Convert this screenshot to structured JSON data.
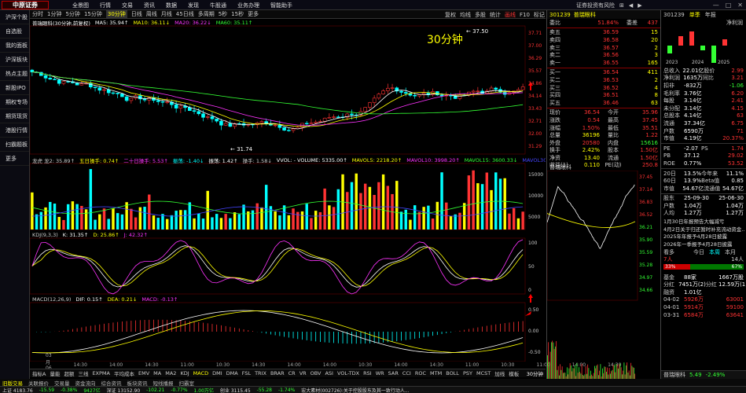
{
  "app": {
    "logo": "中原证券",
    "menu": [
      "全景图",
      "行情",
      "交易",
      "资讯",
      "数据",
      "发现",
      "牛股通",
      "业务办理",
      "智能助手"
    ],
    "top_right": [
      "证券投资有风险",
      "⊞",
      "◀",
      "▶"
    ],
    "window_controls": [
      "—",
      "□",
      "✕"
    ]
  },
  "sidebar": [
    "沪深个股",
    "自选股",
    "我的面板",
    "沪深板块",
    "热点主题",
    "新股IPO",
    "期权专场",
    "期货现货",
    "港股行情",
    "扫霸题板",
    "更多"
  ],
  "toolbar": {
    "periods": [
      "分时",
      "1分钟",
      "5分钟",
      "15分钟",
      "30分钟",
      "日线",
      "周线",
      "月线",
      "45日线",
      "多周期",
      "5秒",
      "15秒",
      "更多"
    ],
    "active_period": "30分钟",
    "tools": [
      "复权",
      "均线",
      "多股",
      "统计",
      "画线",
      "F10",
      "标记",
      "◧",
      "⊠"
    ]
  },
  "chart": {
    "title": "30分钟",
    "stock_legend": [
      {
        "t": "普瑞眼科(30分钟,前复权)",
        "c": "#fff"
      },
      {
        "t": "MA5: 35.94↑",
        "c": "#fff"
      },
      {
        "t": "MA10: 36.11↓",
        "c": "#ff0"
      },
      {
        "t": "MA20: 36.22↓",
        "c": "#f3f"
      },
      {
        "t": "MA60: 35.11↑",
        "c": "#3f3"
      }
    ],
    "price_labels": {
      "high": "37.50",
      "low": "31.74"
    },
    "y_axis": [
      "37.71",
      "37.00",
      "36.29",
      "35.57",
      "34.86",
      "34.14",
      "33.43",
      "32.71",
      "32.00",
      "31.29"
    ],
    "vol_legend": [
      {
        "t": "龙虎 龙2: 35.89↑",
        "c": "#ccc"
      },
      {
        "t": "五日操手: 0.74↑",
        "c": "#ff0"
      },
      {
        "t": "二十日操手: 5.53↑",
        "c": "#f3f"
      },
      {
        "t": "振荡: -1.40↓",
        "c": "#0ff"
      },
      {
        "t": "振荡: 1.42↑",
        "c": "#fff"
      },
      {
        "t": "操手: 1.58↓",
        "c": "#ccc"
      },
      {
        "t": "VVOL: - VOLUME: 5335.00↑",
        "c": "#fff"
      },
      {
        "t": "MAVOL5: 2218.20↑",
        "c": "#ff0"
      },
      {
        "t": "MAVOL10: 3998.20↑",
        "c": "#f3f"
      },
      {
        "t": "MAVOL15: 3600.33↓",
        "c": "#3f3"
      },
      {
        "t": "MAVOL30: 3342.40↑",
        "c": "#44f"
      },
      {
        "t": "MAVOL60: 3442.40↑",
        "c": "#ccc"
      }
    ],
    "vol_axis": [
      "15000",
      "10000",
      "5000"
    ],
    "kdj_legend": [
      {
        "t": "KDJ(9,3,3)",
        "c": "#ccc"
      },
      {
        "t": "K: 31.35↑",
        "c": "#fff"
      },
      {
        "t": "D: 25.86↑",
        "c": "#ff0"
      },
      {
        "t": "J: 42.32↑",
        "c": "#f3f"
      }
    ],
    "kdj_axis": [
      "100",
      "50",
      "0"
    ],
    "macd_legend": [
      {
        "t": "MACD(12,26,9)",
        "c": "#ccc"
      },
      {
        "t": "DIF: 0.15↑",
        "c": "#fff"
      },
      {
        "t": "DEA: 0.21↓",
        "c": "#ff0"
      },
      {
        "t": "MACD: -0.13↑",
        "c": "#f3f"
      }
    ],
    "macd_axis": [
      "0.50",
      "0.00",
      "-0.50"
    ],
    "time_labels": [
      "03月06日",
      "14:30",
      "14:00",
      "14:30",
      "11:00",
      "10:30",
      "14:30",
      "14:00",
      "14:00",
      "10:30",
      "14:00",
      "14:30",
      "11:00",
      "10:30",
      "11:00",
      "14:00",
      "14:30"
    ],
    "indicator_tabs": [
      "指标A",
      "量能",
      "超额",
      "三线",
      "EXPMA",
      "平均成本",
      "EMV",
      "MA",
      "MA2",
      "KDJ",
      "MACD",
      "DMI",
      "DMA",
      "FSL",
      "TRIX",
      "BRAR",
      "CR",
      "VR",
      "OBV",
      "ASI",
      "VOL-TDX",
      "RSI",
      "WR",
      "SAR",
      "CCI",
      "ROC",
      "MTM",
      "BOLL",
      "PSY",
      "MCST",
      "加线",
      "模板"
    ],
    "indicator_active": "MACD",
    "period_tab": "30分钟"
  },
  "quote": {
    "code": "301239",
    "name": "普瑞眼科",
    "webi": {
      "label": "委比",
      "value": "51.84%",
      "label2": "委差",
      "value2": "437"
    },
    "asks": [
      {
        "l": "卖五",
        "p": "36.59",
        "v": "15"
      },
      {
        "l": "卖四",
        "p": "36.58",
        "v": "20"
      },
      {
        "l": "卖三",
        "p": "36.57",
        "v": "2"
      },
      {
        "l": "卖二",
        "p": "36.56",
        "v": "3"
      },
      {
        "l": "卖一",
        "p": "36.55",
        "v": "165"
      }
    ],
    "bids": [
      {
        "l": "买一",
        "p": "36.54",
        "v": "411"
      },
      {
        "l": "买二",
        "p": "36.53",
        "v": "2"
      },
      {
        "l": "买三",
        "p": "36.52",
        "v": "4"
      },
      {
        "l": "买四",
        "p": "36.51",
        "v": "8"
      },
      {
        "l": "买五",
        "p": "36.46",
        "v": "63"
      }
    ],
    "stats": [
      {
        "a": "现价",
        "b": "36.54",
        "c": "今开",
        "d": "35.96"
      },
      {
        "a": "涨跌",
        "b": "0.54",
        "c": "最高",
        "d": "37.45"
      },
      {
        "a": "涨幅",
        "b": "1.50%",
        "c": "最低",
        "d": "35.51"
      },
      {
        "a": "总量",
        "b": "36196",
        "c": "量比",
        "d": "1.22"
      },
      {
        "a": "外盘",
        "b": "20580",
        "c": "内盘",
        "d": "15616"
      },
      {
        "a": "换手",
        "b": "2.42%",
        "c": "股本",
        "d": "1.50亿"
      },
      {
        "a": "净资",
        "b": "13.40",
        "c": "流通",
        "d": "1.50亿"
      },
      {
        "a": "收益(1)",
        "b": "0.110",
        "c": "PE(动)",
        "d": "250.8"
      }
    ],
    "mini_chart_title": "普瑞眼科",
    "mini_axis": [
      "37.45",
      "37.14",
      "36.83",
      "36.52",
      "36.21",
      "35.90",
      "35.59",
      "35.28",
      "34.97",
      "34.66"
    ]
  },
  "finance": {
    "code": "301239",
    "tabs": [
      "单季",
      "年报"
    ],
    "chart_label": "净利润",
    "years": [
      "2023",
      "2024",
      "2025"
    ],
    "rows": [
      {
        "k": "总收入",
        "v": "22.01亿",
        "k2": "股价",
        "v2": "2.99"
      },
      {
        "k": "净利润",
        "v": "1635万",
        "k2": "同比",
        "v2": "3.21"
      },
      {
        "k": "扣非",
        "v": "-832万",
        "k2": "",
        "v2": "-1.06"
      },
      {
        "k": "毛利率",
        "v": "3.76亿",
        "k2": "",
        "v2": "6.20"
      },
      {
        "k": "每股",
        "v": "3.14亿",
        "k2": "",
        "v2": "2.41"
      },
      {
        "k": "未分配",
        "v": "3.14亿",
        "k2": "",
        "v2": "4.15"
      },
      {
        "k": "总股本",
        "v": "4.14亿",
        "k2": "",
        "v2": "63"
      },
      {
        "k": "流通",
        "v": "37.34亿",
        "k2": "",
        "v2": "6.75"
      },
      {
        "k": "户数",
        "v": "6590万",
        "k2": "",
        "v2": "71"
      },
      {
        "k": "市值",
        "v": "4.19亿",
        "k2": "",
        "v2": "20.37%"
      }
    ],
    "ratios": [
      {
        "k": "PE",
        "v": "-2.07",
        "k2": "PS",
        "v2": "1.74"
      },
      {
        "k": "PB",
        "v": "37.12",
        "k2": "",
        "v2": "29.02"
      },
      {
        "k": "ROE",
        "v": "0.77%",
        "k2": "",
        "v2": "53.52"
      }
    ],
    "period": [
      {
        "k": "20日",
        "v": "13.5%",
        "k2": "今年来",
        "v2": "11.1%"
      },
      {
        "k": "60日",
        "v": "13.9%",
        "k2": "Beta值",
        "v2": "0.85"
      },
      {
        "k": "市值",
        "v": "54.67亿",
        "k2": "流通值",
        "v2": "54.67亿"
      }
    ],
    "events": [
      {
        "k": "股东",
        "v": "25-09-30",
        "v2": "25-06-30"
      },
      {
        "k": "户数",
        "v": "1.04万",
        "v2": "1.04万"
      },
      {
        "k": "人均",
        "v": "1.27万",
        "v2": "1.27万"
      }
    ],
    "news": [
      "1月30日年报预告大幅减亏",
      "4月2日关于归还暂时补充流动资金..",
      "2025年年报予4月28日披露",
      "2026年一季报予4月28日披露"
    ],
    "vote": {
      "label": "看多",
      "tabs": [
        "今日",
        "本周",
        "本月"
      ],
      "up": "33%",
      "down": "67%",
      "count": "7人",
      "count2": "14人"
    },
    "flow": [
      {
        "k": "基金",
        "v": "88家",
        "k2": "",
        "v2": "1667万股"
      },
      {
        "k": "分红",
        "v": "7451万(2)",
        "k2": "分红",
        "v2": "12.59万(1)"
      },
      {
        "k": "融资",
        "v": "1.01亿",
        "k2": "",
        "v2": ""
      }
    ],
    "dates": [
      {
        "d": "04-02",
        "v": "5926万",
        "v2": "63001"
      },
      {
        "d": "04-01",
        "v": "5914万",
        "v2": "59100"
      },
      {
        "d": "03-31",
        "v": "6584万",
        "v2": "63641"
      }
    ],
    "bottom_name": "普瑞眼科",
    "bottom_price": "5.49",
    "bottom_pct": "-2.49%"
  },
  "bottom_tabs": [
    "旧版交易",
    "关联报价",
    "交易量",
    "资金流向",
    "综合资讯",
    "板块资讯",
    "短线播报",
    "扫霸室"
  ],
  "ticker": [
    "上证 4183.76",
    "-15.59",
    "-0.38%",
    "9427亿",
    "深证 13152.90",
    "-102.21",
    "-0.77%",
    "1.00万亿",
    "创业 3115.45",
    "-55.28",
    "-1.74%",
    "宏大素材(002726):关于控股股东及其一致行动人..."
  ]
}
